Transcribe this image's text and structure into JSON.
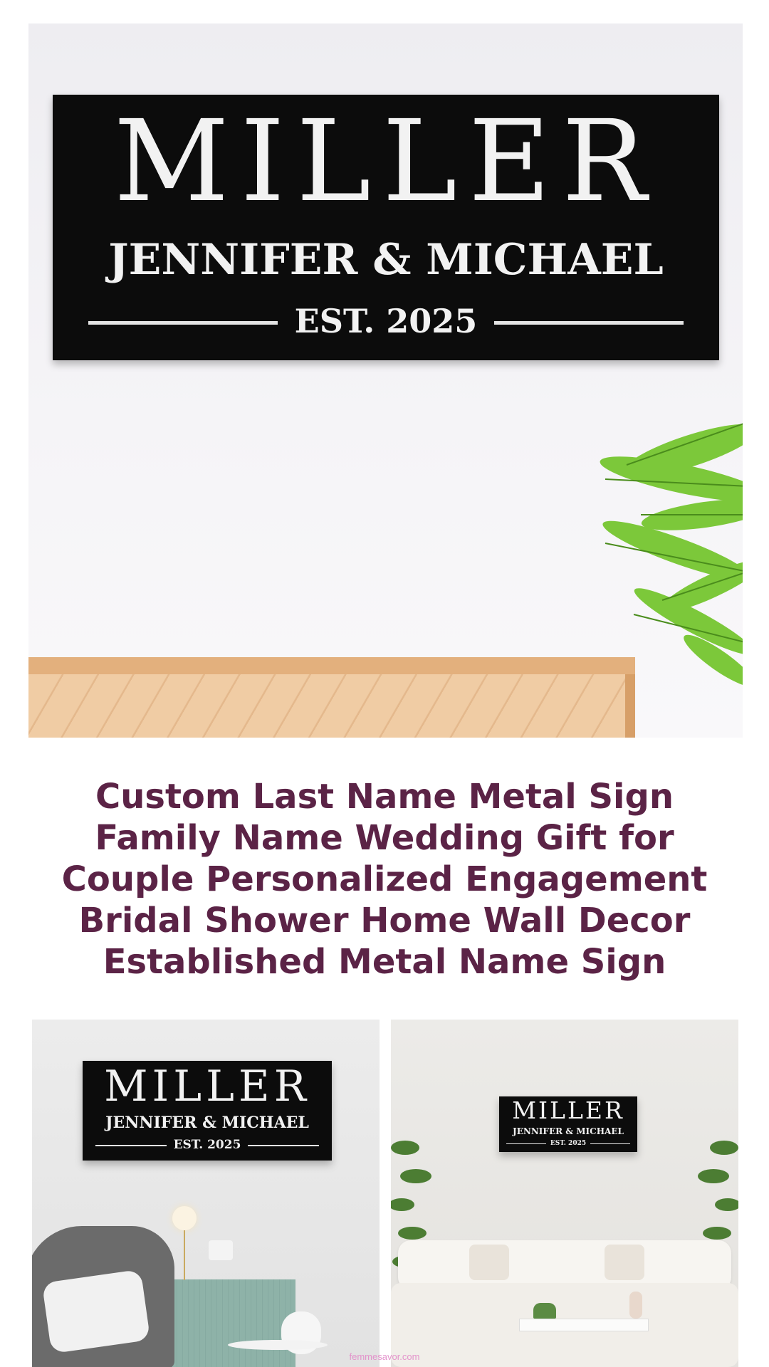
{
  "hero": {
    "sign": {
      "surname": "MILLER",
      "names": "JENNIFER & MICHAEL",
      "established": "EST. 2025"
    },
    "colors": {
      "plaque": "#0c0c0c",
      "wall": "#f2f1f4",
      "wood": "#e8b988",
      "plant": "#6bbf2a"
    }
  },
  "product": {
    "title": "Custom Last Name Metal Sign Family Name Wedding Gift for Couple Personalized Engagement Bridal Shower Home Wall Decor Established Metal Name Sign",
    "title_color": "#5b2346"
  },
  "thumbnails": [
    {
      "surname": "MILLER",
      "names": "JENNIFER & MICHAEL",
      "established": "EST. 2025"
    },
    {
      "surname": "MILLER",
      "names": "JENNIFER & MICHAEL",
      "established": "EST. 2025"
    }
  ],
  "watermark": "femmesavor.com"
}
